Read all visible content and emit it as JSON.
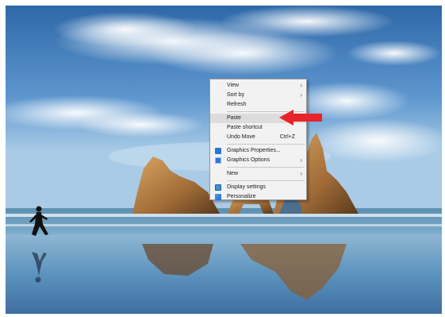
{
  "context_menu": {
    "items": [
      {
        "label": "View",
        "submenu": true
      },
      {
        "label": "Sort by",
        "submenu": true
      },
      {
        "label": "Refresh"
      },
      {
        "label": "Paste",
        "highlighted": true
      },
      {
        "label": "Paste shortcut"
      },
      {
        "label": "Undo Move",
        "shortcut": "Ctrl+Z"
      },
      {
        "label": "Graphics Properties...",
        "icon": "graphics-properties-icon"
      },
      {
        "label": "Graphics Options",
        "icon": "graphics-options-icon",
        "submenu": true
      },
      {
        "label": "New",
        "submenu": true
      },
      {
        "label": "Display settings",
        "icon": "display-settings-icon"
      },
      {
        "label": "Personalize",
        "icon": "personalize-icon"
      }
    ],
    "submenu_glyph": "›"
  },
  "colors": {
    "annotation_arrow": "#e8232a",
    "menu_background": "#f2f2f2",
    "menu_highlight": "#dcdcdc"
  }
}
